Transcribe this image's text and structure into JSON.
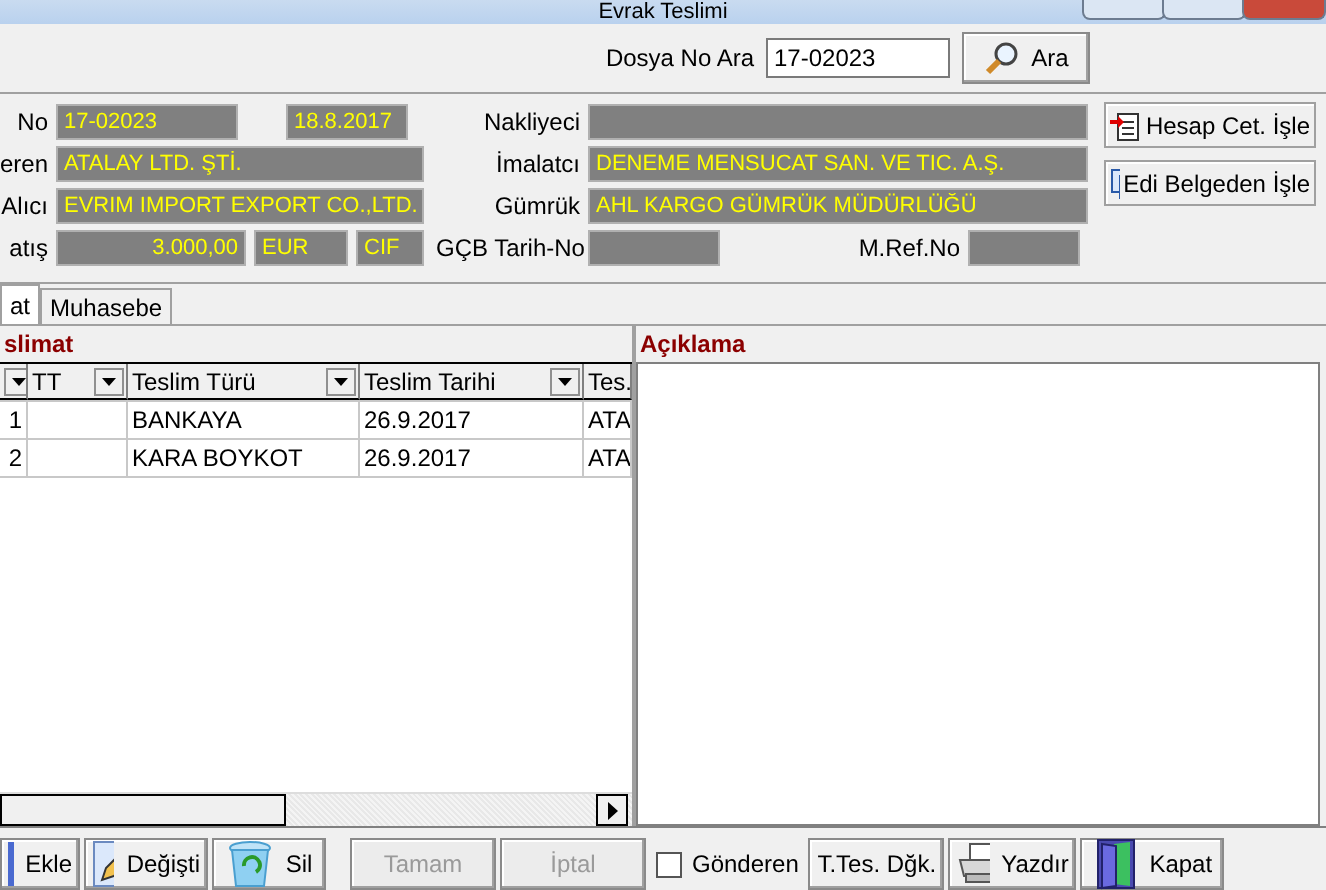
{
  "window": {
    "title": "Evrak Teslimi"
  },
  "search": {
    "label": "Dosya No Ara",
    "value": "17-02023",
    "button": "Ara"
  },
  "left_rows": [
    {
      "label": "No",
      "fields": [
        "17-02023",
        "18.8.2017"
      ]
    },
    {
      "label": "eren",
      "fields": [
        "ATALAY LTD. ŞTİ."
      ]
    },
    {
      "label": "Alıcı",
      "fields": [
        "EVRIM IMPORT EXPORT CO.,LTD."
      ]
    },
    {
      "label": "atış",
      "fields": [
        "3.000,00",
        "EUR",
        "CIF"
      ]
    }
  ],
  "mid_rows": [
    {
      "label": "Nakliyeci"
    },
    {
      "label": "İmalatcı",
      "value": "DENEME MENSUCAT SAN. VE TIC. A.Ş."
    },
    {
      "label": "Gümrük",
      "value": "AHL KARGO GÜMRÜK MÜDÜRLÜĞÜ"
    }
  ],
  "gcb": {
    "label": "GÇB Tarih-No",
    "ref_label": "M.Ref.No"
  },
  "side_buttons": [
    {
      "label": "Hesap Cet. İşle",
      "kind": "sheet"
    },
    {
      "label": "Edi Belgeden İşle",
      "kind": "copy"
    }
  ],
  "tabs": [
    {
      "label": "at",
      "selected": true
    },
    {
      "label": "Muhasebe",
      "selected": false
    }
  ],
  "grid": {
    "title": "slimat",
    "columns": [
      "TT",
      "Teslim Türü",
      "Teslim Tarihi",
      "Tes."
    ],
    "rows": [
      {
        "no": "1",
        "tt": "",
        "type": "BANKAYA",
        "date": "26.9.2017",
        "rest": "ATA"
      },
      {
        "no": "2",
        "tt": "",
        "type": "KARA BOYKOT",
        "date": "26.9.2017",
        "rest": "ATA"
      }
    ]
  },
  "notes": {
    "title": "Açıklama"
  },
  "footer": [
    {
      "label": "Ekle",
      "kind": "add",
      "disabled": false
    },
    {
      "label": "Değişti",
      "kind": "edit",
      "disabled": false
    },
    {
      "label": "Sil",
      "kind": "trash",
      "disabled": false
    },
    {
      "label": "Tamam",
      "kind": "plain",
      "disabled": true
    },
    {
      "label": "İptal",
      "kind": "plain",
      "disabled": true
    },
    {
      "label": "Gönderen",
      "kind": "check",
      "checked": false
    },
    {
      "label": "T.Tes. Dğk.",
      "kind": "plain",
      "disabled": false
    },
    {
      "label": "Yazdır",
      "kind": "print",
      "disabled": false
    },
    {
      "label": "Kapat",
      "kind": "door",
      "disabled": false
    }
  ]
}
